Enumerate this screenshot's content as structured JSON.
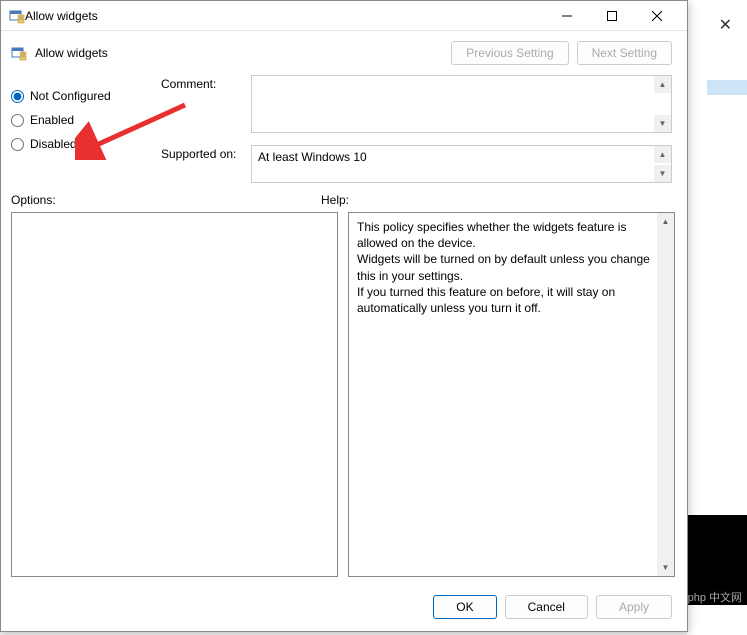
{
  "window": {
    "title": "Allow widgets"
  },
  "header": {
    "title": "Allow widgets",
    "prev_setting": "Previous Setting",
    "next_setting": "Next Setting"
  },
  "radios": {
    "not_configured": "Not Configured",
    "enabled": "Enabled",
    "disabled": "Disabled",
    "selected": "not_configured"
  },
  "fields": {
    "comment_label": "Comment:",
    "comment_value": "",
    "supported_label": "Supported on:",
    "supported_value": "At least Windows 10"
  },
  "panes": {
    "options_label": "Options:",
    "help_label": "Help:",
    "help_text": "This policy specifies whether the widgets feature is allowed on the device.\nWidgets will be turned on by default unless you change this in your settings.\nIf you turned this feature on before, it will stay on automatically unless you turn it off."
  },
  "buttons": {
    "ok": "OK",
    "cancel": "Cancel",
    "apply": "Apply"
  },
  "watermark": "php 中文网"
}
